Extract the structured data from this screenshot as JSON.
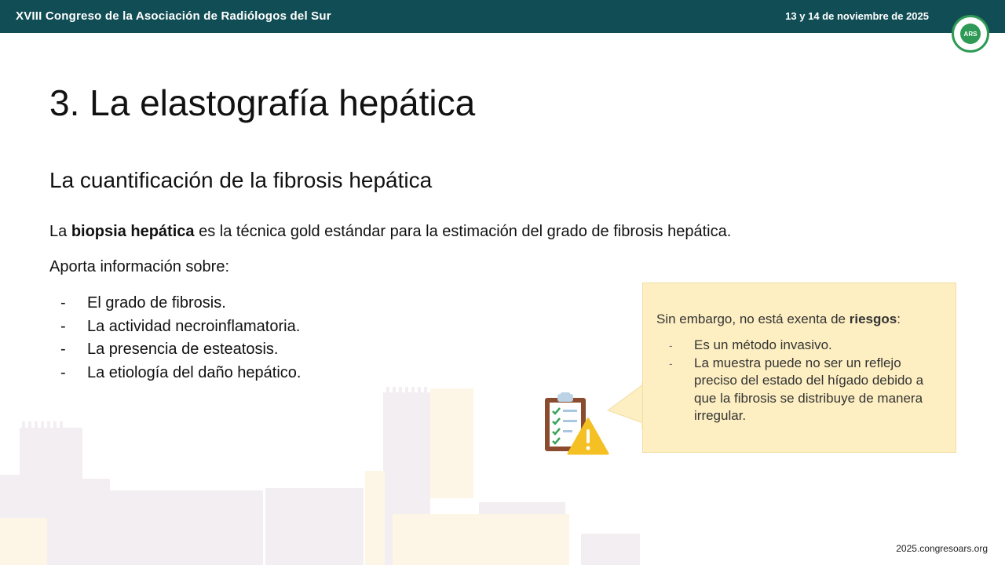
{
  "header": {
    "conference": "XVIII Congreso de la Asociación de Radiólogos del Sur",
    "date": "13 y 14 de noviembre de 2025",
    "logo_text": "ARS"
  },
  "slide": {
    "title": "3. La elastografía hepática",
    "subtitle": "La cuantificación de la fibrosis hepática",
    "intro_prefix": "La ",
    "intro_bold": "biopsia hepática",
    "intro_suffix": " es la técnica gold estándar para la estimación del grado de fibrosis hepática.",
    "aporta": "Aporta información sobre:",
    "bullet_marker": "-",
    "bullets": [
      "El grado de fibrosis.",
      "La actividad necroinflamatoria.",
      "La presencia de esteatosis.",
      "La etiología del daño hepático."
    ]
  },
  "callout": {
    "lead_prefix": "Sin embargo, no está exenta de ",
    "lead_bold": "riesgos",
    "lead_suffix": ":",
    "items": [
      "Es un método invasivo.",
      "La muestra puede no ser un reflejo preciso del estado del hígado debido a que la fibrosis se distribuye de manera irregular."
    ],
    "icon": "clipboard-warning-icon"
  },
  "footer": {
    "url": "2025.congresoars.org"
  },
  "colors": {
    "header_bg": "#114d55",
    "callout_bg": "#fdefc2",
    "skyline_a": "#f3eef1",
    "skyline_b": "#fdf6e6"
  }
}
